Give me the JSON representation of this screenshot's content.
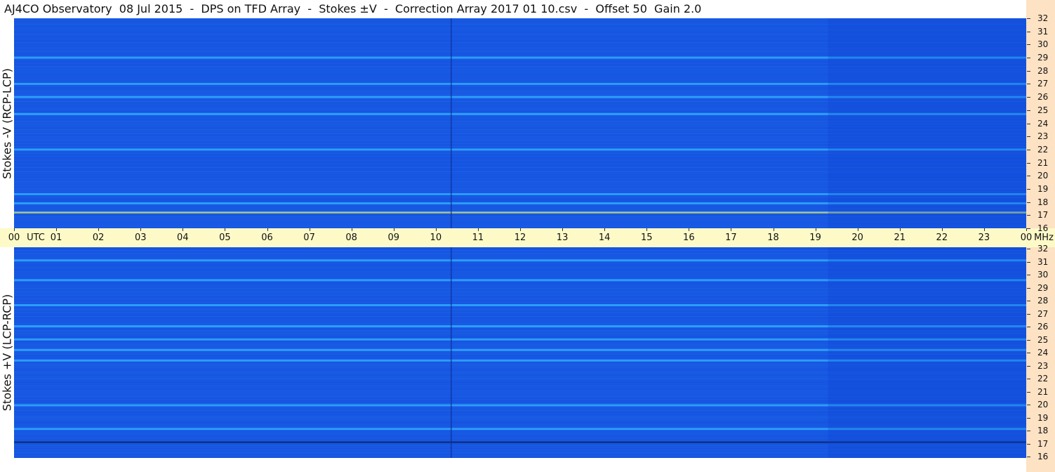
{
  "title": "AJ4CO Observatory  08 Jul 2015  -  DPS on TFD Array  -  Stokes ±V  -  Correction Array 2017 01 10.csv  -  Offset 50  Gain 2.0",
  "panels": [
    {
      "ylabel": "Stokes -V (RCP-LCP)"
    },
    {
      "ylabel": "Stokes +V (LCP-RCP)"
    }
  ],
  "time_axis": {
    "labels": [
      "00",
      "01",
      "02",
      "03",
      "04",
      "05",
      "06",
      "07",
      "08",
      "09",
      "10",
      "11",
      "12",
      "13",
      "14",
      "15",
      "16",
      "17",
      "18",
      "19",
      "20",
      "21",
      "22",
      "23",
      "00"
    ],
    "utc_label": "UTC",
    "mhz_label": "MHz"
  },
  "freq_axis": {
    "labels": [
      "32",
      "31",
      "30",
      "29",
      "28",
      "27",
      "26",
      "25",
      "24",
      "23",
      "22",
      "21",
      "20",
      "19",
      "18",
      "17",
      "16"
    ]
  },
  "colors": {
    "background": "#1553e0",
    "time_bar": "#fefac8",
    "freq_bar": "#fde2c4",
    "bright": "#2fa9ff",
    "hot": "#ffd23a"
  },
  "chart_data": [
    {
      "type": "heatmap",
      "title": "Stokes -V (RCP-LCP)",
      "x_range": [
        "00 UTC",
        "00 UTC next day"
      ],
      "xlabel": "UTC",
      "ylabel": "MHz",
      "ylim": [
        16,
        32
      ],
      "bright_bands_mhz": [
        29,
        27,
        26,
        24.7,
        22,
        18.6,
        17.9,
        17.2
      ],
      "hot_band_mhz": 17.2
    },
    {
      "type": "heatmap",
      "title": "Stokes +V (LCP-RCP)",
      "x_range": [
        "00 UTC",
        "00 UTC next day"
      ],
      "xlabel": "UTC",
      "ylabel": "MHz",
      "ylim": [
        16,
        32
      ],
      "bright_bands_mhz": [
        31,
        29.5,
        27.6,
        26,
        25,
        24.2,
        23.4,
        20,
        18.2
      ],
      "dark_band_mhz": 17.2
    }
  ]
}
